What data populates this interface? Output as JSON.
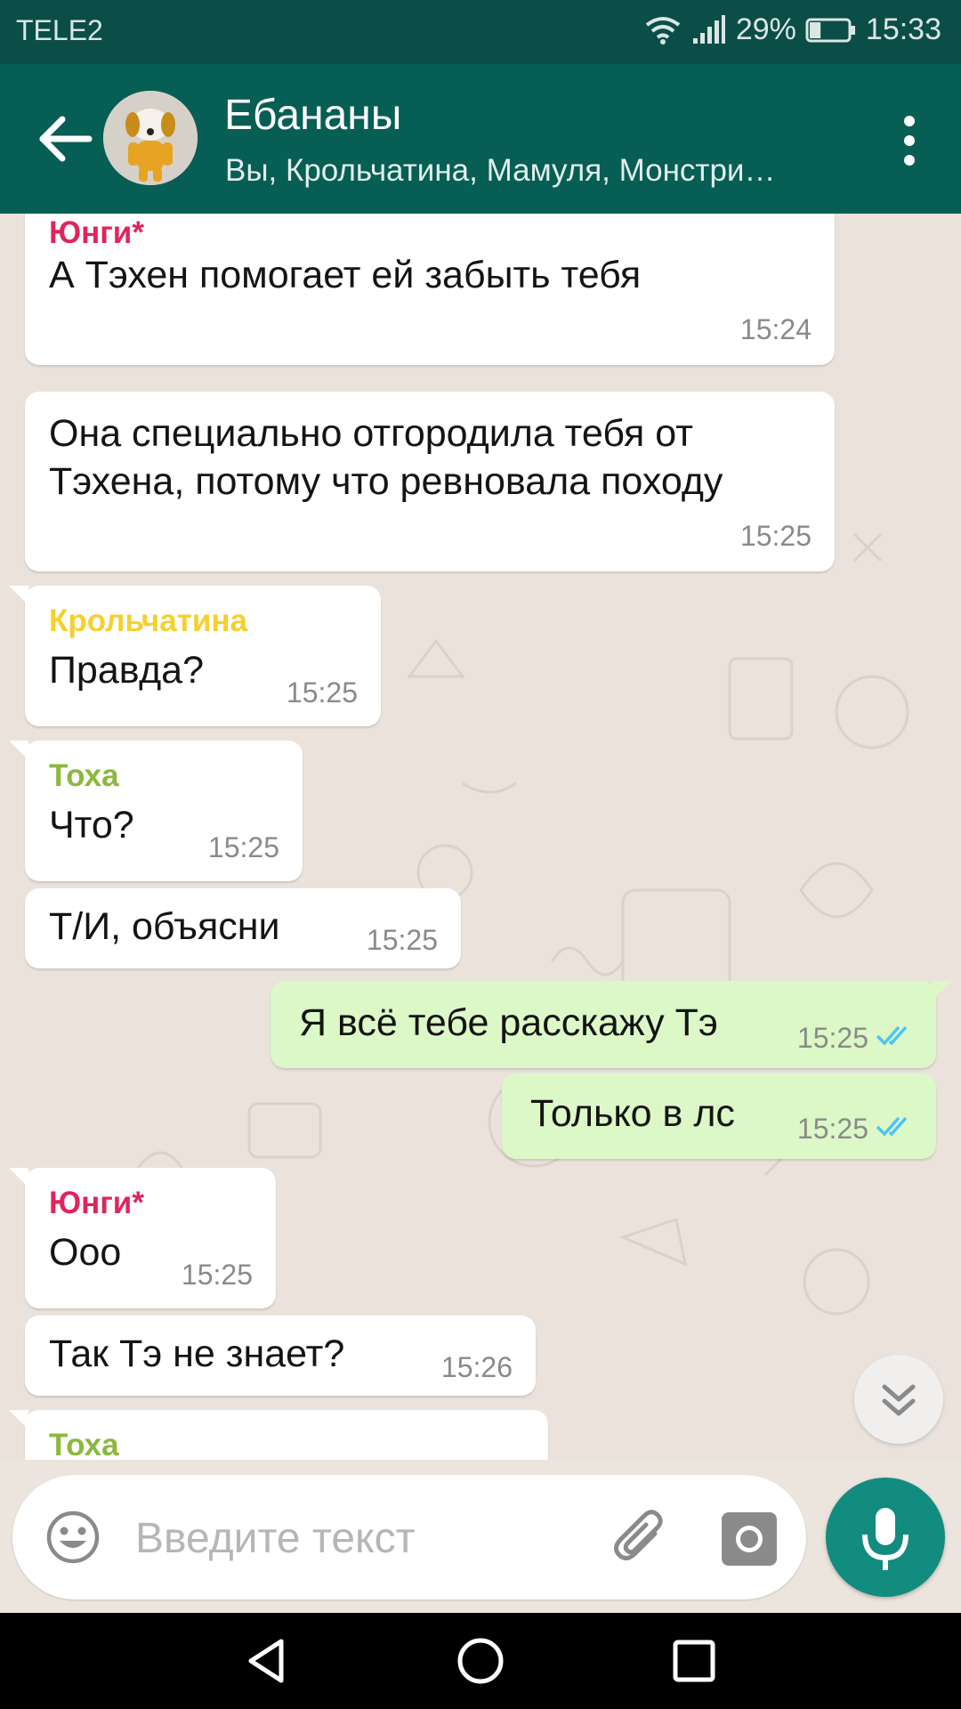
{
  "status_bar": {
    "carrier": "TELE2",
    "battery_percent": "29%",
    "battery_level": 0.29,
    "time": "15:33",
    "icons": [
      "wifi-icon",
      "signal-icon",
      "battery-icon"
    ]
  },
  "header": {
    "title": "Ебананы",
    "subtitle": "Вы, Крольчатина, Мамуля, Монстри…",
    "back_icon": "arrow-left-icon",
    "menu_icon": "more-vert-icon",
    "avatar_icon": "group-avatar"
  },
  "colors": {
    "header": "#075e54",
    "status_bar": "#0b4d47",
    "outgoing_bubble": "#dcf8c6",
    "incoming_bubble": "#ffffff",
    "sender_yungi": "#e0245e",
    "sender_krolchatina": "#f5d02f",
    "sender_toha": "#8bb83d",
    "read_ticks": "#4fc3f7",
    "mic_button": "#128c7e"
  },
  "messages": [
    {
      "direction": "in",
      "sender": "Юнги*",
      "text": "А Тэхен помогает ей забыть тебя",
      "time": "15:24"
    },
    {
      "direction": "in",
      "sender": "",
      "text_lines": [
        "Она специально отгородила тебя от",
        "Тэхена, потому что ревновала походу"
      ],
      "time": "15:25"
    },
    {
      "direction": "in",
      "sender": "Крольчатина",
      "text": "Правда?",
      "time": "15:25"
    },
    {
      "direction": "in",
      "sender": "Тоха",
      "text": "Что?",
      "time": "15:25"
    },
    {
      "direction": "in",
      "sender": "",
      "text": "Т/И, объясни",
      "time": "15:25"
    },
    {
      "direction": "out",
      "text": "Я всё тебе расскажу Тэ",
      "time": "15:25",
      "status": "read"
    },
    {
      "direction": "out",
      "text": "Только в лс",
      "time": "15:25",
      "status": "read"
    },
    {
      "direction": "in",
      "sender": "Юнги*",
      "text": "Ооо",
      "time": "15:25"
    },
    {
      "direction": "in",
      "sender": "",
      "text": "Так Тэ не знает?",
      "time": "15:26"
    },
    {
      "direction": "in",
      "sender": "Тоха",
      "text": "",
      "time": ""
    }
  ],
  "composer": {
    "placeholder": "Введите текст",
    "emoji_icon": "emoji-icon",
    "attach_icon": "paperclip-icon",
    "camera_icon": "camera-icon",
    "mic_icon": "microphone-icon"
  },
  "scroll_down_icon": "double-chevron-down-icon",
  "nav_bar": {
    "icons": [
      "back-triangle-icon",
      "home-circle-icon",
      "recents-square-icon"
    ]
  }
}
